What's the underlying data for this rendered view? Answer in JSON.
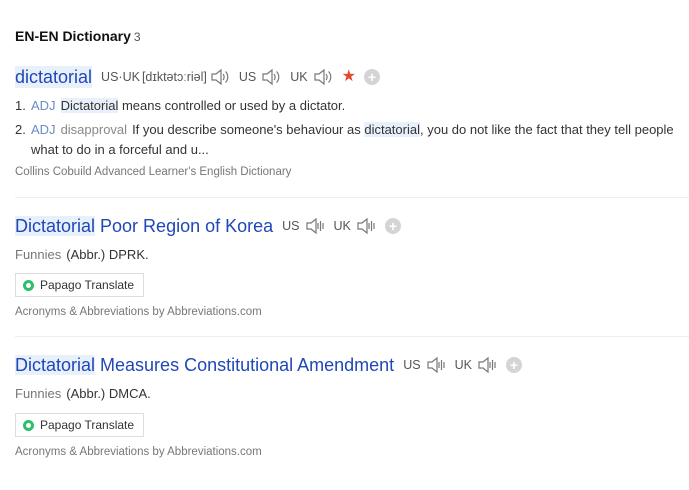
{
  "section": {
    "title": "EN-EN Dictionary",
    "count": "3"
  },
  "entries": [
    {
      "headword": "dictatorial",
      "pron_label": "US·UK",
      "ipa": "[dɪktətɔːriəl]",
      "us_label": "US",
      "uk_label": "UK",
      "star": "★",
      "defs": [
        {
          "num": "1.",
          "pos": "ADJ",
          "word": "Dictatorial",
          "text": " means controlled or used by a dictator."
        },
        {
          "num": "2.",
          "pos": "ADJ",
          "mark": "disapproval",
          "text_a": "If you describe someone's behaviour as ",
          "word": "dictatorial",
          "text_b": ", you do not like the fact that they tell people what to do in a forceful and u..."
        }
      ],
      "source": "Collins Cobuild Advanced Learner's English Dictionary"
    },
    {
      "headword_hl": "Dictatorial",
      "headword_rest": " Poor Region of Korea",
      "us_label": "US",
      "uk_label": "UK",
      "tag": "Funnies",
      "text": "(Abbr.) DPRK.",
      "papago": "Papago Translate",
      "source": "Acronyms & Abbreviations by Abbreviations.com"
    },
    {
      "headword_hl": "Dictatorial",
      "headword_rest": " Measures Constitutional Amendment",
      "us_label": "US",
      "uk_label": "UK",
      "tag": "Funnies",
      "text": "(Abbr.) DMCA.",
      "papago": "Papago Translate",
      "source": "Acronyms & Abbreviations by Abbreviations.com"
    }
  ],
  "icons": {
    "speaker": "speaker-icon",
    "add": "plus-circle-icon",
    "favorite": "star-icon",
    "papago": "papago-icon"
  },
  "colors": {
    "headword": "#1f47b8",
    "highlight": "#e8f1fb",
    "star": "#e44930",
    "pos": "#6a8cc4"
  }
}
